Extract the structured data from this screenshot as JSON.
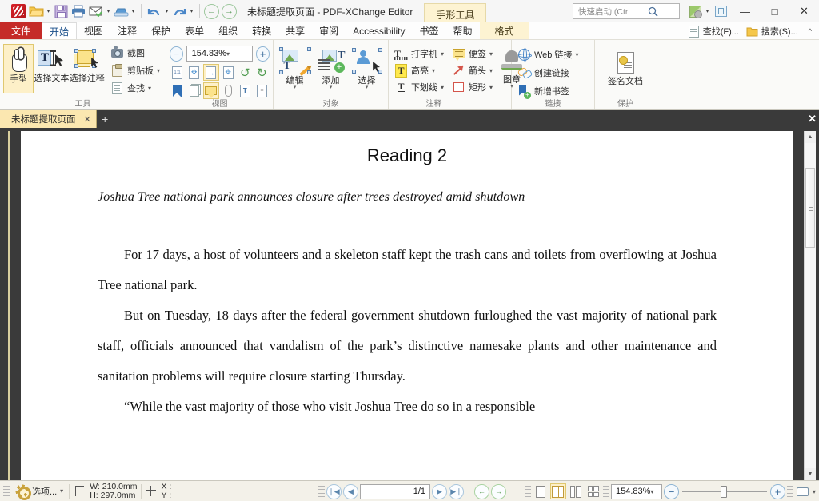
{
  "window": {
    "title": "未标题提取页面  - PDF-XChange Editor",
    "tool_tab": "手形工具",
    "minimize": "—",
    "maximize": "□",
    "close": "✕"
  },
  "quick_access": {
    "items": [
      {
        "name": "app-logo",
        "label": "PDF-XChange"
      },
      {
        "name": "open-icon",
        "label": "打开"
      },
      {
        "name": "save-icon",
        "label": "保存"
      },
      {
        "name": "print-icon",
        "label": "打印"
      },
      {
        "name": "email-icon",
        "label": "邮件"
      },
      {
        "name": "scan-icon",
        "label": "扫描"
      },
      {
        "name": "undo-icon",
        "label": "撤销"
      },
      {
        "name": "redo-icon",
        "label": "重做"
      },
      {
        "name": "back-icon",
        "label": "后退"
      },
      {
        "name": "forward-icon",
        "label": "前进"
      }
    ]
  },
  "search": {
    "placeholder": "快速启动 (Ctrl+.)"
  },
  "menubar": {
    "file": "文件",
    "items": [
      "开始",
      "视图",
      "注释",
      "保护",
      "表单",
      "组织",
      "转换",
      "共享",
      "审阅",
      "Accessibility",
      "书签",
      "帮助"
    ],
    "active": "开始",
    "format_tab": "格式",
    "right_buttons": [
      "查找(F)...",
      "搜索(S)..."
    ],
    "collapse": "^"
  },
  "ribbon": {
    "groups": [
      {
        "label": "工具",
        "big_buttons": [
          {
            "label": "手型",
            "selected": true
          },
          {
            "label": "选择文本",
            "selected": false
          },
          {
            "label": "选择注释",
            "selected": false
          }
        ],
        "small_buttons": [
          "截图",
          "剪贴板",
          "查找"
        ]
      },
      {
        "label": "视图",
        "zoom_value": "154.83%"
      },
      {
        "label": "对象",
        "big_buttons": [
          {
            "label": "编辑"
          },
          {
            "label": "添加"
          },
          {
            "label": "选择"
          }
        ]
      },
      {
        "label": "注释",
        "small_buttons": [
          "打字机",
          "便签",
          "高亮",
          "箭头",
          "下划线",
          "矩形"
        ],
        "big_buttons": [
          {
            "label": "图章"
          }
        ]
      },
      {
        "label": "链接",
        "small_buttons": [
          "Web 链接",
          "创建链接",
          "新增书签"
        ]
      },
      {
        "label": "保护",
        "big_buttons": [
          {
            "label": "签名文档"
          }
        ]
      }
    ]
  },
  "tabs": {
    "documents": [
      {
        "label": "未标题提取页面",
        "close": "✕"
      }
    ],
    "new_tab": "+",
    "close_all": "✕"
  },
  "document": {
    "title": "Reading 2",
    "subtitle": "Joshua Tree national park announces closure after trees destroyed amid shutdown",
    "paragraphs": [
      "For 17 days, a host of volunteers and a skeleton staff kept the trash cans and toilets from overflowing at Joshua Tree national park.",
      "But on Tuesday, 18 days after the federal government shutdown furloughed the vast majority of national park staff, officials announced that vandalism of the park’s distinctive namesake plants and other maintenance and sanitation problems will require closure starting Thursday.",
      "“While the vast majority of those who visit Joshua Tree do so in a responsible"
    ]
  },
  "statusbar": {
    "options_label": "选项...",
    "width_label": "W: 210.0mm",
    "height_label": "H: 297.0mm",
    "x_label": "X :",
    "y_label": "Y :",
    "page_indicator": "1/1",
    "zoom_value": "154.83%",
    "nav_first": "❘◀",
    "nav_prev": "◀",
    "nav_next": "▶",
    "nav_last": "▶❘",
    "nav_back": "←",
    "nav_forward": "→"
  },
  "colors": {
    "accent_red": "#c52b28",
    "tab_yellow": "#fbe7b0",
    "ribbon_bg": "#fafaf8",
    "doc_bg": "#3a3a3a",
    "page_white": "#ffffff"
  }
}
